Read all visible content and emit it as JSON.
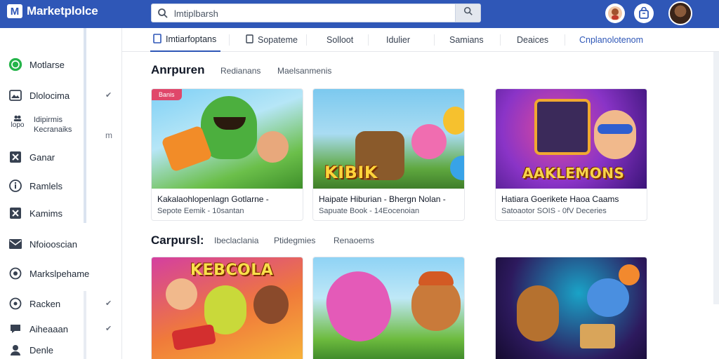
{
  "app": {
    "logo_letter": "M",
    "title": "Marketplolce"
  },
  "search": {
    "placeholder": "",
    "value": "lmtiplbarsh"
  },
  "sidebar": {
    "items": [
      {
        "label": "Motlarse",
        "icon": "whatsapp-icon"
      },
      {
        "label": "Dlolocima",
        "icon": "image-icon",
        "chevron": true
      },
      {
        "label": "Idipirmis",
        "sub": "Kecranaiks",
        "icon": "people-icon",
        "extra": "lopo"
      },
      {
        "label": "Ganar",
        "icon": "close-box-icon"
      },
      {
        "label": "Ramlels",
        "icon": "info-icon"
      },
      {
        "label": "Kamims",
        "icon": "close-box-icon"
      },
      {
        "label": "Nfoiooscian",
        "icon": "mail-icon"
      },
      {
        "label": "Markslpehame",
        "icon": "pin-icon"
      },
      {
        "label": "Racken",
        "icon": "clock-icon",
        "chevron": true
      },
      {
        "label": "Aiheaaan",
        "icon": "chat-icon",
        "chevron": true
      },
      {
        "label": "Denle",
        "icon": "person-icon"
      }
    ],
    "side_marker": "m"
  },
  "tabs": [
    {
      "label": "Imtiarfoptans",
      "active": true
    },
    {
      "label": "Sopateme"
    },
    {
      "label": "Solloot"
    },
    {
      "label": "Idulier"
    },
    {
      "label": "Samians"
    },
    {
      "label": "Deaices"
    },
    {
      "label": "Cnplanolotenom",
      "link": true
    }
  ],
  "sections": [
    {
      "title": "Anrpuren",
      "filters": [
        "Redianans",
        "Maelsanmenis"
      ],
      "cards": [
        {
          "badge": "Banis",
          "image_word": "",
          "title": "Kakalaohlopenlagn Gotlarne -",
          "subtitle": "Sepote Eemik - 10santan",
          "colors": [
            "#6bbf4a",
            "#f28c28"
          ]
        },
        {
          "image_word": "KIBIK",
          "title": "Haipate Hiburian - Bhergn Nolan -",
          "subtitle": "Sapuate Book - 14Eocenoian",
          "colors": [
            "#7cc9ef",
            "#5fa83f"
          ]
        },
        {
          "image_word": "AAKLEMONS",
          "title": "Hatiara Goerikete Haoa Caams",
          "subtitle": "Satoaotor SOIS - 0fV Deceries",
          "colors": [
            "#6a2fb0",
            "#e04a9a"
          ]
        }
      ]
    },
    {
      "title": "Carpursl:",
      "filters": [
        "Ibeclaclania",
        "Ptidegmies",
        "Renaoems"
      ],
      "cards": [
        {
          "image_word": "KEBCOLA",
          "title": "",
          "subtitle": "",
          "colors": [
            "#d43fa0",
            "#f6b23a"
          ]
        },
        {
          "image_word": "",
          "title": "",
          "subtitle": "",
          "colors": [
            "#8fd3f5",
            "#6dbb3e"
          ]
        },
        {
          "image_word": "",
          "title": "",
          "subtitle": "",
          "colors": [
            "#2d1a5e",
            "#1aa3c7"
          ]
        }
      ]
    }
  ],
  "colors": {
    "header": "#2f57b7",
    "accent": "#2f57b7",
    "badge": "#e0476a"
  }
}
